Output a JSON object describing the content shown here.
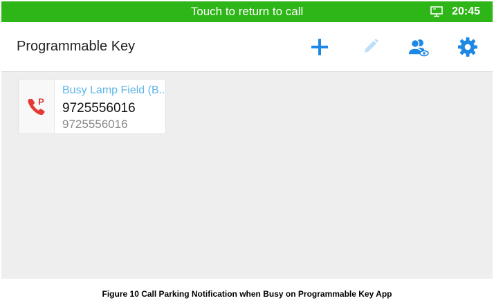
{
  "status_bar": {
    "message": "Touch to return to call",
    "time": "20:45",
    "icon": "screen-icon"
  },
  "app_bar": {
    "title": "Programmable Key",
    "actions": [
      {
        "name": "add",
        "icon": "plus-icon",
        "color": "#1e88e5"
      },
      {
        "name": "edit",
        "icon": "pencil-icon",
        "color": "#bbdefb"
      },
      {
        "name": "contacts",
        "icon": "contacts-icon",
        "color": "#1e88e5"
      },
      {
        "name": "settings",
        "icon": "gear-icon",
        "color": "#1e88e5"
      }
    ]
  },
  "keys": [
    {
      "icon": "parked-call-icon",
      "label": "Busy Lamp Field (B...",
      "number": "9725556016",
      "sub": "9725556016"
    }
  ],
  "caption": "Figure 10 Call Parking Notification when Busy on Programmable Key App",
  "colors": {
    "status_green": "#2eb517",
    "accent_blue": "#1e88e5",
    "label_blue": "#5fb5e6",
    "park_red": "#e53935"
  }
}
